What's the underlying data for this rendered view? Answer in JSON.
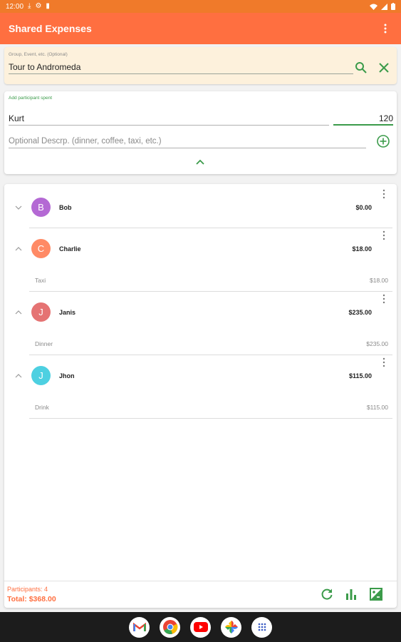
{
  "status_bar": {
    "time": "12:00"
  },
  "app_bar": {
    "title": "Shared Expenses",
    "menu_icon": "more-vert-icon"
  },
  "group": {
    "label": "Group, Event, etc. (Optional)",
    "value": "Tour to Andromeda",
    "search_icon": "search-icon",
    "clear_icon": "close-icon"
  },
  "add_participant": {
    "label": "Add participant spent",
    "name_value": "Kurt",
    "amount_value": "120",
    "description_placeholder": "Optional Descrp. (dinner, coffee, taxi, etc.)",
    "add_icon": "add-circle-icon",
    "collapse_icon": "chevron-up-icon"
  },
  "participants": [
    {
      "initial": "B",
      "name": "Bob",
      "amount": "$0.00",
      "color": "#b469d4",
      "expanded": false,
      "items": []
    },
    {
      "initial": "C",
      "name": "Charlie",
      "amount": "$18.00",
      "color": "#ff8a65",
      "expanded": true,
      "items": [
        {
          "label": "Taxi",
          "amount": "$18.00"
        }
      ]
    },
    {
      "initial": "J",
      "name": "Janis",
      "amount": "$235.00",
      "color": "#e57373",
      "expanded": true,
      "items": [
        {
          "label": "Dinner",
          "amount": "$235.00"
        }
      ]
    },
    {
      "initial": "J",
      "name": "Jhon",
      "amount": "$115.00",
      "color": "#4dd0e1",
      "expanded": true,
      "items": [
        {
          "label": "Drink",
          "amount": "$115.00"
        }
      ]
    }
  ],
  "footer": {
    "participants_text": "Participants: 4",
    "total_text": "Total: $368.00",
    "icons": [
      "refresh-icon",
      "bar-chart-icon",
      "image-aspect-icon"
    ]
  },
  "dock": {
    "icons": [
      "gmail-icon",
      "chrome-icon",
      "youtube-icon",
      "photos-icon",
      "app-drawer-icon"
    ]
  },
  "colors": {
    "accent": "#ff6f40",
    "status_bar": "#f07a2a",
    "green": "#3b9b4a",
    "group_card": "#fdf1dc"
  }
}
